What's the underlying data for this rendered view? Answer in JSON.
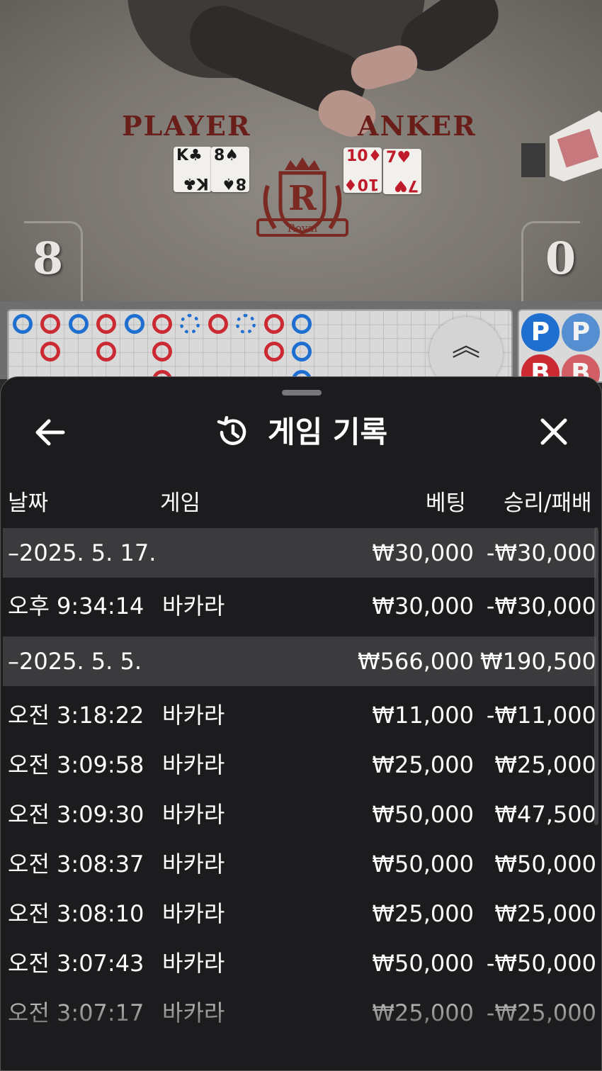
{
  "table": {
    "player_label": "PLAYER",
    "banker_label": "ANKER",
    "player_score": "8",
    "banker_score": "0",
    "crest_letter": "R",
    "crest_word": "Royal",
    "player_cards": [
      {
        "rank": "K",
        "suit": "♣",
        "color": "black"
      },
      {
        "rank": "8",
        "suit": "♠",
        "color": "black"
      }
    ],
    "banker_cards": [
      {
        "rank": "10",
        "suit": "♦",
        "color": "red"
      },
      {
        "rank": "7",
        "suit": "♥",
        "color": "red"
      }
    ]
  },
  "road": {
    "expand_glyph": "︽",
    "pair_player": "P",
    "pair_banker": "B"
  },
  "sheet": {
    "title": "게임 기록",
    "back_icon": "arrow-left-icon",
    "close_icon": "close-icon",
    "history_icon": "history-icon",
    "columns": {
      "date": "날짜",
      "game": "게임",
      "bet": "베팅",
      "result": "승리/패배"
    },
    "groups": [
      {
        "date": "–2025. 5. 17.",
        "bet": "₩30,000",
        "result": "-₩30,000",
        "rows": [
          {
            "time": "오후 9:34:14",
            "game": "바카라",
            "bet": "₩30,000",
            "result": "-₩30,000"
          }
        ]
      },
      {
        "date": "–2025. 5. 5.",
        "bet": "₩566,000",
        "result": "₩190,500",
        "rows": [
          {
            "time": "오전 3:18:22",
            "game": "바카라",
            "bet": "₩11,000",
            "result": "-₩11,000"
          },
          {
            "time": "오전 3:09:58",
            "game": "바카라",
            "bet": "₩25,000",
            "result": "₩25,000"
          },
          {
            "time": "오전 3:09:30",
            "game": "바카라",
            "bet": "₩50,000",
            "result": "₩47,500"
          },
          {
            "time": "오전 3:08:37",
            "game": "바카라",
            "bet": "₩50,000",
            "result": "₩50,000"
          },
          {
            "time": "오전 3:08:10",
            "game": "바카라",
            "bet": "₩25,000",
            "result": "₩25,000"
          },
          {
            "time": "오전 3:07:43",
            "game": "바카라",
            "bet": "₩50,000",
            "result": "-₩50,000"
          },
          {
            "time": "오전 3:07:17",
            "game": "바카라",
            "bet": "₩25,000",
            "result": "-₩25,000"
          }
        ]
      }
    ]
  }
}
